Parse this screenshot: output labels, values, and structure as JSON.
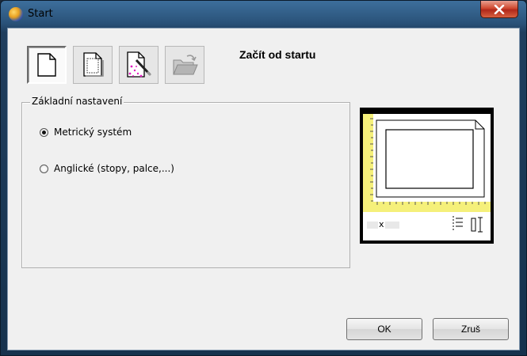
{
  "window": {
    "title": "Start"
  },
  "toolbar": {
    "heading": "Začít od startu",
    "buttons": [
      {
        "icon": "blank-page-icon",
        "active": true
      },
      {
        "icon": "template-page-icon",
        "active": false
      },
      {
        "icon": "wizard-icon",
        "active": false
      },
      {
        "icon": "open-folder-icon",
        "active": false
      }
    ]
  },
  "settings": {
    "group_label": "Základní nastavení",
    "options": [
      {
        "label": "Metrický systém",
        "checked": true
      },
      {
        "label": "Anglické (stopy, palce,...)",
        "checked": false
      }
    ]
  },
  "preview": {
    "ruler_color": "#f5f07a",
    "dimension_separator": "x"
  },
  "footer": {
    "ok_label": "OK",
    "cancel_label": "Zruš"
  }
}
